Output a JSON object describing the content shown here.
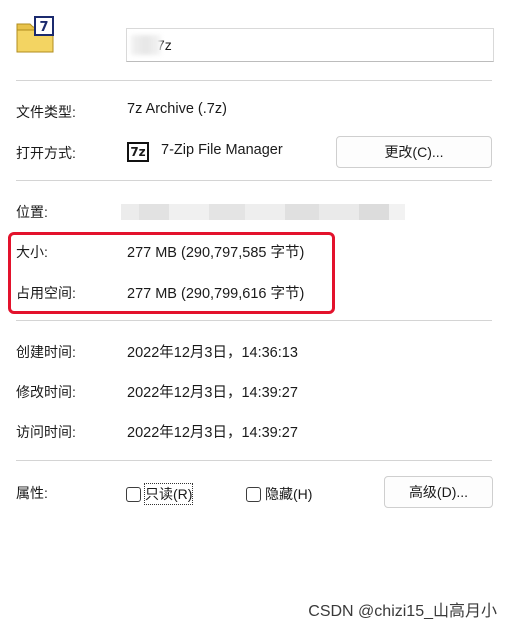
{
  "header": {
    "file_icon": "7z-archive-icon",
    "file_name": "7z"
  },
  "details": {
    "file_type_label": "文件类型:",
    "file_type_value": "7z Archive (.7z)",
    "opens_with_label": "打开方式:",
    "opens_with_icon": "7zip-app-icon",
    "opens_with_icon_text": "7z",
    "opens_with_value": "7-Zip File Manager",
    "change_button": "更改(C)...",
    "location_label": "位置:"
  },
  "size": {
    "size_label": "大小:",
    "size_value": "277 MB (290,797,585 字节)",
    "size_on_disk_label": "占用空间:",
    "size_on_disk_value": "277 MB (290,799,616 字节)"
  },
  "dates": {
    "created_label": "创建时间:",
    "created_value": "2022年12月3日，14:36:13",
    "modified_label": "修改时间:",
    "modified_value": "2022年12月3日，14:39:27",
    "accessed_label": "访问时间:",
    "accessed_value": "2022年12月3日，14:39:27"
  },
  "attributes": {
    "label": "属性:",
    "readonly_label": "只读(R)",
    "hidden_label": "隐藏(H)",
    "advanced_button": "高级(D)..."
  },
  "watermark": "CSDN @chizi15_山高月小",
  "colors": {
    "highlight": "#e3122c",
    "separator": "#d4d4d4"
  }
}
